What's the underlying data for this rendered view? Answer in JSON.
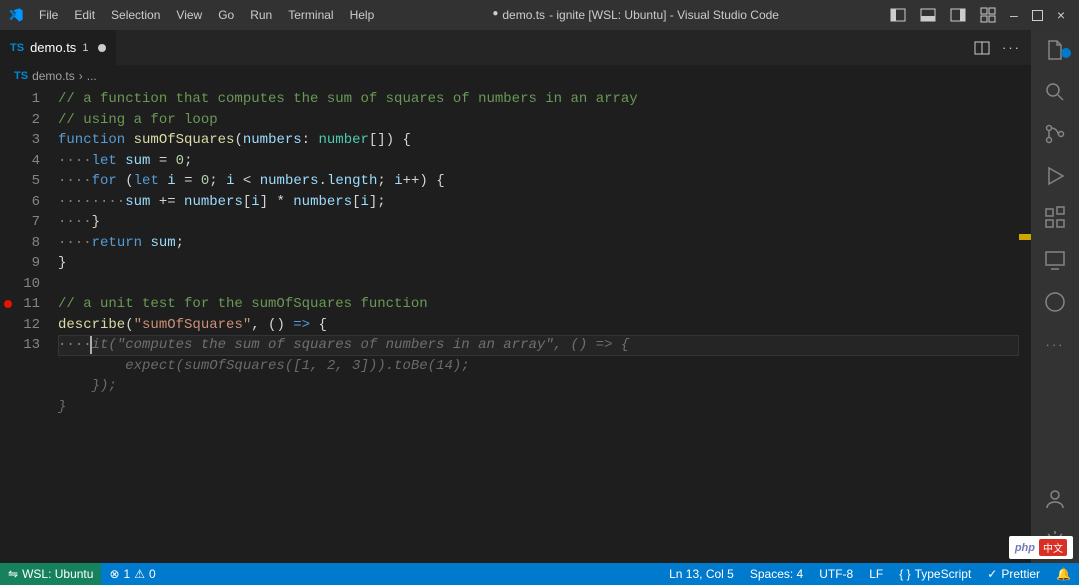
{
  "menu": {
    "file": "File",
    "edit": "Edit",
    "selection": "Selection",
    "view": "View",
    "go": "Go",
    "run": "Run",
    "terminal": "Terminal",
    "help": "Help"
  },
  "title": {
    "modified_dot": "●",
    "filename": "demo.ts",
    "project": "- ignite [WSL: Ubuntu] - Visual Studio Code"
  },
  "tab": {
    "lang": "TS",
    "name": "demo.ts",
    "mod": "1"
  },
  "breadcrumb": {
    "lang": "TS",
    "file": "demo.ts",
    "sep": "›",
    "more": "..."
  },
  "lines": [
    "1",
    "2",
    "3",
    "4",
    "5",
    "6",
    "7",
    "8",
    "9",
    "10",
    "11",
    "12",
    "13"
  ],
  "code": {
    "l1_comment": "// a function that computes the sum of squares of numbers in an array",
    "l2_comment": "// using a for loop",
    "l3_kw1": "function",
    "l3_fn": "sumOfSquares",
    "l3_p1": "(",
    "l3_var": "numbers",
    "l3_colon": ": ",
    "l3_type": "number",
    "l3_arr": "[]) {",
    "l4_dots": "····",
    "l4_let": "let",
    "l4_sp": " ",
    "l4_var": "sum",
    "l4_eq": " = ",
    "l4_num": "0",
    "l4_semi": ";",
    "l5_dots": "····",
    "l5_for": "for",
    "l5_p": " (",
    "l5_let": "let",
    "l5_sp1": " ",
    "l5_i": "i",
    "l5_eq": " = ",
    "l5_z": "0",
    "l5_semi1": "; ",
    "l5_i2": "i",
    "l5_lt": " < ",
    "l5_num": "numbers",
    "l5_dot": ".",
    "l5_len": "length",
    "l5_semi2": "; ",
    "l5_i3": "i",
    "l5_inc": "++) {",
    "l6_dots": "········",
    "l6_sum": "sum",
    "l6_op": " += ",
    "l6_n1": "numbers",
    "l6_b1": "[",
    "l6_i1": "i",
    "l6_b2": "] * ",
    "l6_n2": "numbers",
    "l6_b3": "[",
    "l6_i2": "i",
    "l6_b4": "];",
    "l7_dots": "····",
    "l7_brace": "}",
    "l8_dots": "····",
    "l8_ret": "return",
    "l8_sp": " ",
    "l8_sum": "sum",
    "l8_semi": ";",
    "l9_brace": "}",
    "l11_comment": "// a unit test for the sumOfSquares function",
    "l12_desc": "describe",
    "l12_p1": "(",
    "l12_str": "\"sumOfSquares\"",
    "l12_c": ", () ",
    "l12_arr": "=>",
    "l12_b": " {",
    "l13_dots": "····",
    "l13_ghost": "it(\"computes the sum of squares of numbers in an array\", () => {",
    "l14_ghost": "        expect(sumOfSquares([1, 2, 3])).toBe(14);",
    "l15_ghost": "    });",
    "l16_ghost": "}"
  },
  "status": {
    "remote_icon": "⇋",
    "remote": "WSL: Ubuntu",
    "err_icon": "⊗",
    "err": "1",
    "warn_icon": "⚠",
    "warn": "0",
    "lncol": "Ln 13, Col 5",
    "spaces": "Spaces: 4",
    "enc": "UTF-8",
    "eol": "LF",
    "lang_icon": "{ }",
    "lang": "TypeScript",
    "prettier_icon": "✓",
    "prettier": "Prettier",
    "bell": "🔔"
  },
  "badge": {
    "php": "php",
    "cn": "中文"
  },
  "window_controls": {
    "min": "–",
    "close": "×"
  }
}
